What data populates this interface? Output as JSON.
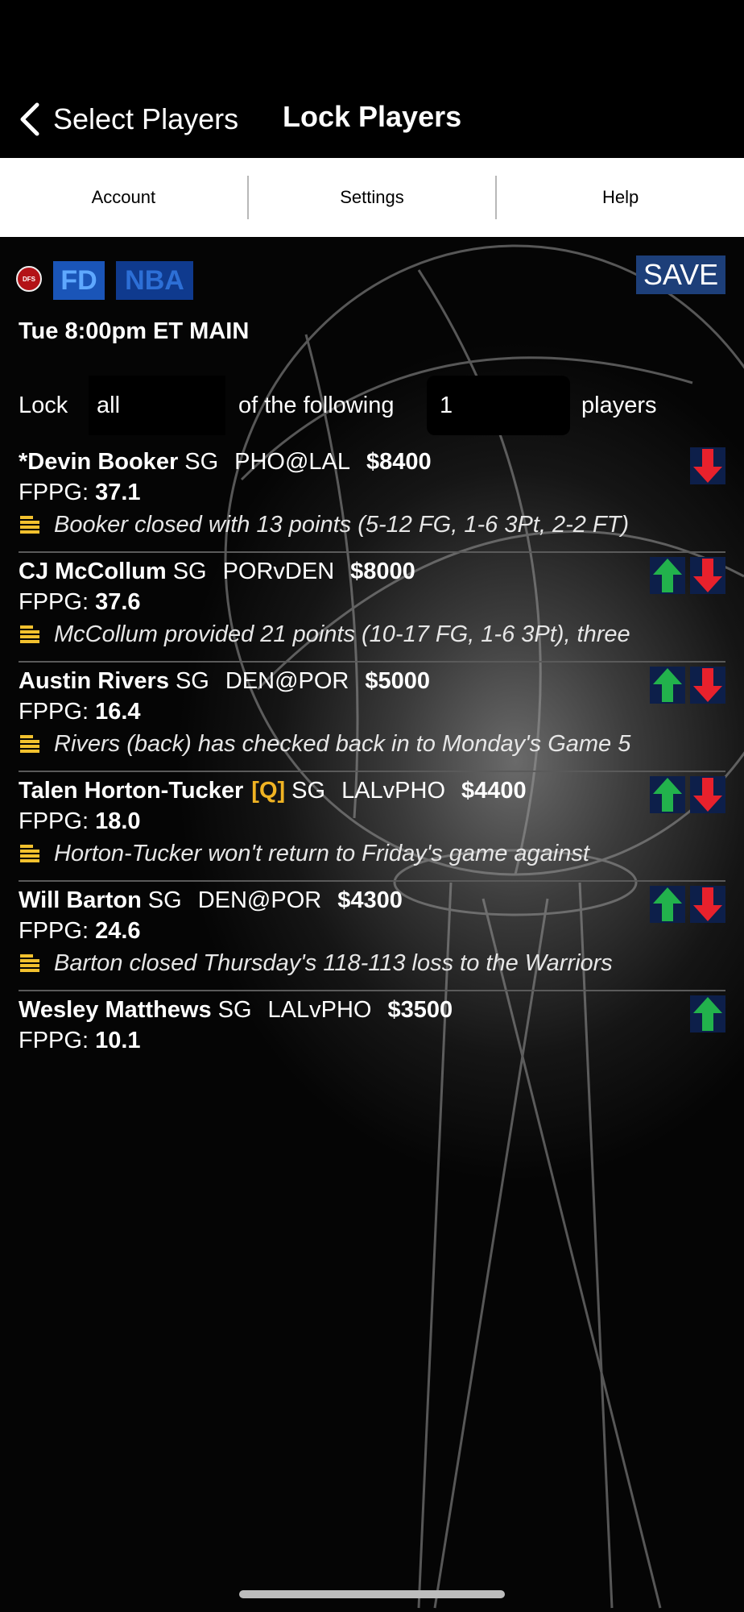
{
  "nav": {
    "back_label": "Select Players",
    "title": "Lock Players"
  },
  "tabs": [
    {
      "label": "Account"
    },
    {
      "label": "Settings"
    },
    {
      "label": "Help"
    }
  ],
  "header": {
    "logo_text": "DFS",
    "site": "FD",
    "sport": "NBA",
    "save_label": "SAVE",
    "slate": "Tue 8:00pm ET MAIN"
  },
  "lock": {
    "label": "Lock",
    "mode": "all",
    "mid_text": "of the following",
    "count": "1",
    "end_text": "players"
  },
  "colors": {
    "up_arrow": "#22b24c",
    "down_arrow": "#e8212c",
    "injury_tag": "#f0b323",
    "note_icon": "#f2c12e"
  },
  "fppg_label": "FPPG:",
  "players": [
    {
      "name": "*Devin Booker",
      "tag": "",
      "pos": "SG",
      "matchup": "PHO@LAL",
      "salary": "$8400",
      "fppg": "37.1",
      "note": "Booker closed with 13 points (5-12 FG, 1-6 3Pt, 2-2 FT)"
    },
    {
      "name": "CJ McCollum",
      "tag": "",
      "pos": "SG",
      "matchup": "PORvDEN",
      "salary": "$8000",
      "fppg": "37.6",
      "note": "McCollum provided 21 points (10-17 FG, 1-6 3Pt), three"
    },
    {
      "name": "Austin Rivers",
      "tag": "",
      "pos": "SG",
      "matchup": "DEN@POR",
      "salary": "$5000",
      "fppg": "16.4",
      "note": "Rivers (back) has checked back in to Monday's Game 5"
    },
    {
      "name": "Talen Horton-Tucker",
      "tag": "[Q]",
      "pos": "SG",
      "matchup": "LALvPHO",
      "salary": "$4400",
      "fppg": "18.0",
      "note": "Horton-Tucker won't return to Friday's game against"
    },
    {
      "name": "Will Barton",
      "tag": "",
      "pos": "SG",
      "matchup": "DEN@POR",
      "salary": "$4300",
      "fppg": "24.6",
      "note": "Barton closed Thursday's 118-113 loss to the Warriors"
    },
    {
      "name": "Wesley Matthews",
      "tag": "",
      "pos": "SG",
      "matchup": "LALvPHO",
      "salary": "$3500",
      "fppg": "10.1",
      "note": ""
    }
  ]
}
